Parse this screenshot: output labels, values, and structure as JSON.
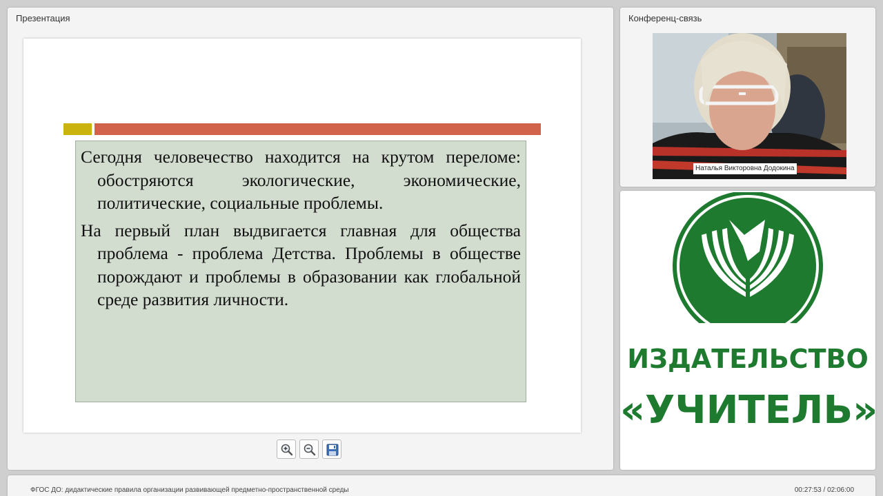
{
  "presentation": {
    "title": "Презентация",
    "slide": {
      "paragraphs": [
        "Сегодня человечество находится на крутом переломе: обостряются экологические, экономические, политические, социальные проблемы.",
        "На первый план выдвигается главная для общества проблема - проблема Детства. Проблемы в обществе порождают и проблемы в образовании как глобальной среде развития личности."
      ],
      "colors": {
        "accent_yellow": "#c9b30c",
        "accent_orange": "#d0634a",
        "box_bg": "#d2dccf"
      }
    },
    "toolbar": {
      "zoom_in_icon": "zoom-in-icon",
      "zoom_out_icon": "zoom-out-icon",
      "save_icon": "floppy-disk-icon"
    }
  },
  "conference": {
    "title": "Конференц-связь",
    "speaker_name": "Наталья Викторовна Додокина"
  },
  "logo": {
    "line1": "ИЗДАТЕЛЬСТВО",
    "line2": "«УЧИТЕЛЬ»",
    "color": "#1d7a2e"
  },
  "footer": {
    "course_title": "ФГОС ДО: дидактические правила организации развивающей предметно-пространственной среды",
    "timer": "00:27:53 / 02:06:00"
  }
}
